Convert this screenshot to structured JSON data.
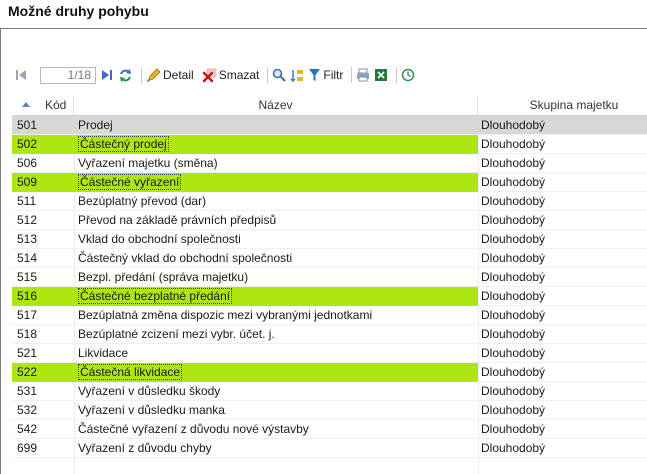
{
  "page": {
    "title": "Možné druhy pohybu"
  },
  "toolbar": {
    "pager_value": "1/18",
    "detail_label": "Detail",
    "delete_label": "Smazat",
    "filter_label": "Filtr",
    "colors": {
      "accent": "#3b6fc4",
      "delete": "#d01515",
      "excel": "#1d7a37",
      "filter": "#2a6fd6"
    }
  },
  "grid": {
    "columns": [
      "Kód",
      "Název",
      "Skupina majetku"
    ],
    "sort": {
      "column": "Kód",
      "direction": "ascending"
    },
    "highlight_color": "#aee60f",
    "selected_color": "#d7d7d7",
    "rows": [
      {
        "kod": "501",
        "nazev": "Prodej",
        "skupina": "Dlouhodobý",
        "state": "selected"
      },
      {
        "kod": "502",
        "nazev": "Částečný prodej",
        "skupina": "Dlouhodobý",
        "state": "highlight"
      },
      {
        "kod": "506",
        "nazev": "Vyřazení majetku (směna)",
        "skupina": "Dlouhodobý",
        "state": ""
      },
      {
        "kod": "509",
        "nazev": "Částečné vyřazení",
        "skupina": "Dlouhodobý",
        "state": "highlight"
      },
      {
        "kod": "511",
        "nazev": "Bezúplatný převod (dar)",
        "skupina": "Dlouhodobý",
        "state": ""
      },
      {
        "kod": "512",
        "nazev": "Převod na základě právních předpisů",
        "skupina": "Dlouhodobý",
        "state": ""
      },
      {
        "kod": "513",
        "nazev": "Vklad do obchodní společnosti",
        "skupina": "Dlouhodobý",
        "state": ""
      },
      {
        "kod": "514",
        "nazev": "Částečný vklad do obchodní společnosti",
        "skupina": "Dlouhodobý",
        "state": ""
      },
      {
        "kod": "515",
        "nazev": "Bezpl. předání (správa majetku)",
        "skupina": "Dlouhodobý",
        "state": ""
      },
      {
        "kod": "516",
        "nazev": "Částečné bezplatné předání",
        "skupina": "Dlouhodobý",
        "state": "highlight"
      },
      {
        "kod": "517",
        "nazev": "Bezúplatná změna dispozic mezi vybranými jednotkami",
        "skupina": "Dlouhodobý",
        "state": ""
      },
      {
        "kod": "518",
        "nazev": "Bezúplatné zcizení mezi vybr. účet. j.",
        "skupina": "Dlouhodobý",
        "state": ""
      },
      {
        "kod": "521",
        "nazev": "Likvidace",
        "skupina": "Dlouhodobý",
        "state": ""
      },
      {
        "kod": "522",
        "nazev": "Částečná likvidace",
        "skupina": "Dlouhodobý",
        "state": "highlight"
      },
      {
        "kod": "531",
        "nazev": "Vyřazení v důsledku škody",
        "skupina": "Dlouhodobý",
        "state": ""
      },
      {
        "kod": "532",
        "nazev": "Vyřazení v důsledku manka",
        "skupina": "Dlouhodobý",
        "state": ""
      },
      {
        "kod": "542",
        "nazev": "Částečné vyřazení z důvodu nové výstavby",
        "skupina": "Dlouhodobý",
        "state": ""
      },
      {
        "kod": "699",
        "nazev": "Vyřazení z důvodu chyby",
        "skupina": "Dlouhodobý",
        "state": ""
      }
    ]
  }
}
